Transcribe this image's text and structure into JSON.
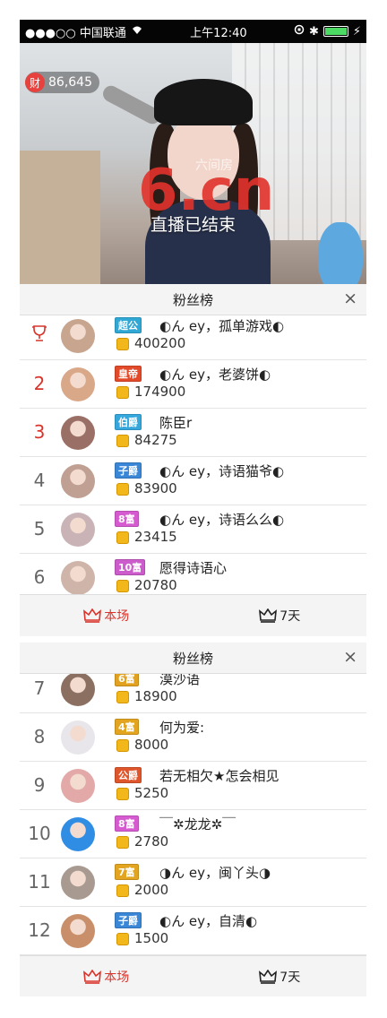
{
  "status_bar": {
    "carrier": "●●●○○ 中国联通",
    "time": "上午12:40",
    "bluetooth": "✱"
  },
  "video": {
    "fortune_icon": "财",
    "fortune_value": "86,645",
    "logo_text": "6.cn",
    "logo_sub": "六间房",
    "ended_text": "直播已结束"
  },
  "panel": {
    "title": "粉丝榜",
    "close": "×",
    "tabs": [
      {
        "label": "本场",
        "active": true
      },
      {
        "label": "7天",
        "active": false
      }
    ]
  },
  "fans_top": [
    {
      "rank": "",
      "trophy": true,
      "badge": "超公",
      "badge_color": "#2fa8d6",
      "name": "◐ん ey，孤单游戏◐",
      "score": "400200",
      "avatar_color": "#c7a58f"
    },
    {
      "rank": "2",
      "badge": "皇帝",
      "badge_color": "#e24a2a",
      "name": "◐ん ey，老婆饼◐",
      "score": "174900",
      "avatar_color": "#d9a889"
    },
    {
      "rank": "3",
      "badge": "伯爵",
      "badge_color": "#34a7dd",
      "name": "陈臣r",
      "score": "84275",
      "avatar_color": "#9a7066"
    },
    {
      "rank": "4",
      "badge": "子爵",
      "badge_color": "#3a87d8",
      "name": "◐ん ey，诗语猫爷◐",
      "score": "83900",
      "avatar_color": "#bfa093"
    },
    {
      "rank": "5",
      "badge": "8富",
      "badge_color": "#d65bd0",
      "name": "◐ん ey，诗语么么◐",
      "score": "23415",
      "avatar_color": "#c9b3b6"
    },
    {
      "rank": "6",
      "badge": "10富",
      "badge_color": "#cc5bcb",
      "name": "愿得诗语心",
      "score": "20780",
      "avatar_color": "#cfb4a9"
    }
  ],
  "fans_bottom": [
    {
      "rank": "7",
      "badge": "6富",
      "badge_color": "#e2a21f",
      "name": "漠沙语",
      "score": "18900",
      "avatar_color": "#8b6f61"
    },
    {
      "rank": "8",
      "badge": "4富",
      "badge_color": "#e3a51f",
      "name": "何为爱:",
      "score": "8000",
      "avatar_color": "#e8e6ea"
    },
    {
      "rank": "9",
      "badge": "公爵",
      "badge_color": "#e0562c",
      "name": "若无相欠★怎会相见",
      "score": "5250",
      "avatar_color": "#e3a9a8"
    },
    {
      "rank": "10",
      "badge": "8富",
      "badge_color": "#d65bd0",
      "name": "￣✲龙龙✲￣",
      "score": "2780",
      "avatar_color": "#2f8de4"
    },
    {
      "rank": "11",
      "badge": "7富",
      "badge_color": "#e3a51f",
      "name": "◑ん ey，闽丫头◑",
      "score": "2000",
      "avatar_color": "#a89a90"
    },
    {
      "rank": "12",
      "badge": "子爵",
      "badge_color": "#3a87d8",
      "name": "◐ん ey，自清◐",
      "score": "1500",
      "avatar_color": "#c98f6a"
    }
  ]
}
